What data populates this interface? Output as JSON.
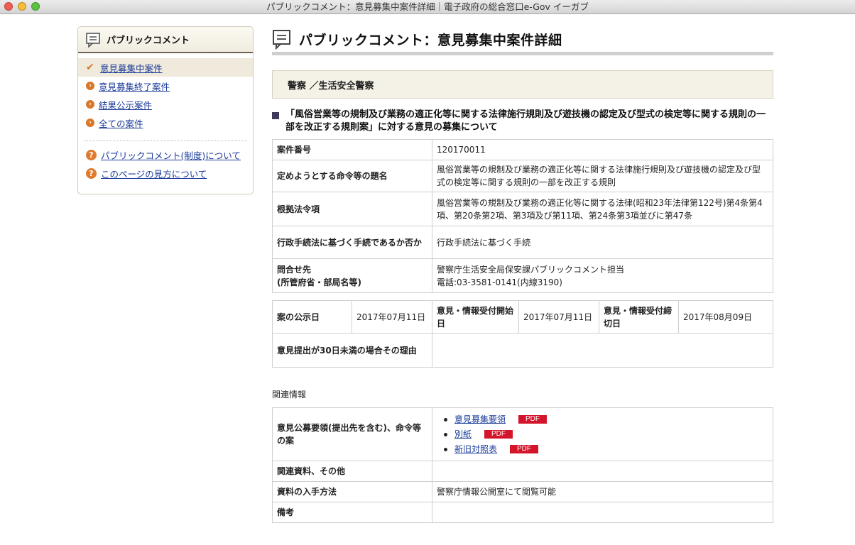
{
  "window": {
    "title": "パブリックコメント：意見募集中案件詳細｜電子政府の総合窓口e-Gov イーガブ"
  },
  "sidebar": {
    "heading": "パブリックコメント",
    "items": [
      {
        "label": "意見募集中案件",
        "active": true
      },
      {
        "label": "意見募集終了案件"
      },
      {
        "label": "結果公示案件"
      },
      {
        "label": "全ての案件"
      }
    ],
    "help": [
      {
        "label": "パブリックコメント(制度)について"
      },
      {
        "label": "このページの見方について"
      }
    ]
  },
  "main": {
    "page_title": "パブリックコメント：意見募集中案件詳細",
    "agency": "警察 ／生活安全警察",
    "case_title": "「風俗営業等の規制及び業務の適正化等に関する法律施行規則及び遊技機の認定及び型式の検定等に関する規則の一部を改正する規則案」に対する意見の募集について",
    "details": {
      "case_no_label": "案件番号",
      "case_no": "120170011",
      "order_title_label": "定めようとする命令等の題名",
      "order_title": "風俗営業等の規制及び業務の適正化等に関する法律施行規則及び遊技機の認定及び型式の検定等に関する規則の一部を改正する規則",
      "basis_label": "根拠法令項",
      "basis": "風俗営業等の規制及び業務の適正化等に関する法律(昭和23年法律第122号)第4条第4項、第20条第2項、第3項及び第11項、第24条第3項並びに第47条",
      "procedure_label": "行政手続法に基づく手続であるか否か",
      "procedure": "行政手続法に基づく手続",
      "contact_label_1": "問合せ先",
      "contact_label_2": "(所管府省・部局名等)",
      "contact_1": "警察庁生活安全局保安課パブリックコメント担当",
      "contact_2": "電話:03-3581-0141(内線3190)"
    },
    "dates": {
      "announce_label": "案の公示日",
      "announce": "2017年07月11日",
      "start_label": "意見・情報受付開始日",
      "start": "2017年07月11日",
      "end_label": "意見・情報受付締切日",
      "end": "2017年08月09日",
      "short_reason_label": "意見提出が30日未満の場合その理由",
      "short_reason": ""
    },
    "related_heading": "関連情報",
    "related": {
      "draft_label": "意見公募要領(提出先を含む)、命令等の案",
      "files": [
        {
          "name": "意見募集要領",
          "badge": "PDF"
        },
        {
          "name": "別紙",
          "badge": "PDF"
        },
        {
          "name": "新旧対照表",
          "badge": "PDF"
        }
      ],
      "materials_label": "関連資料、その他",
      "materials": "",
      "obtain_label": "資料の入手方法",
      "obtain": "警察庁情報公開室にて閲覧可能",
      "remarks_label": "備考",
      "remarks": ""
    }
  }
}
